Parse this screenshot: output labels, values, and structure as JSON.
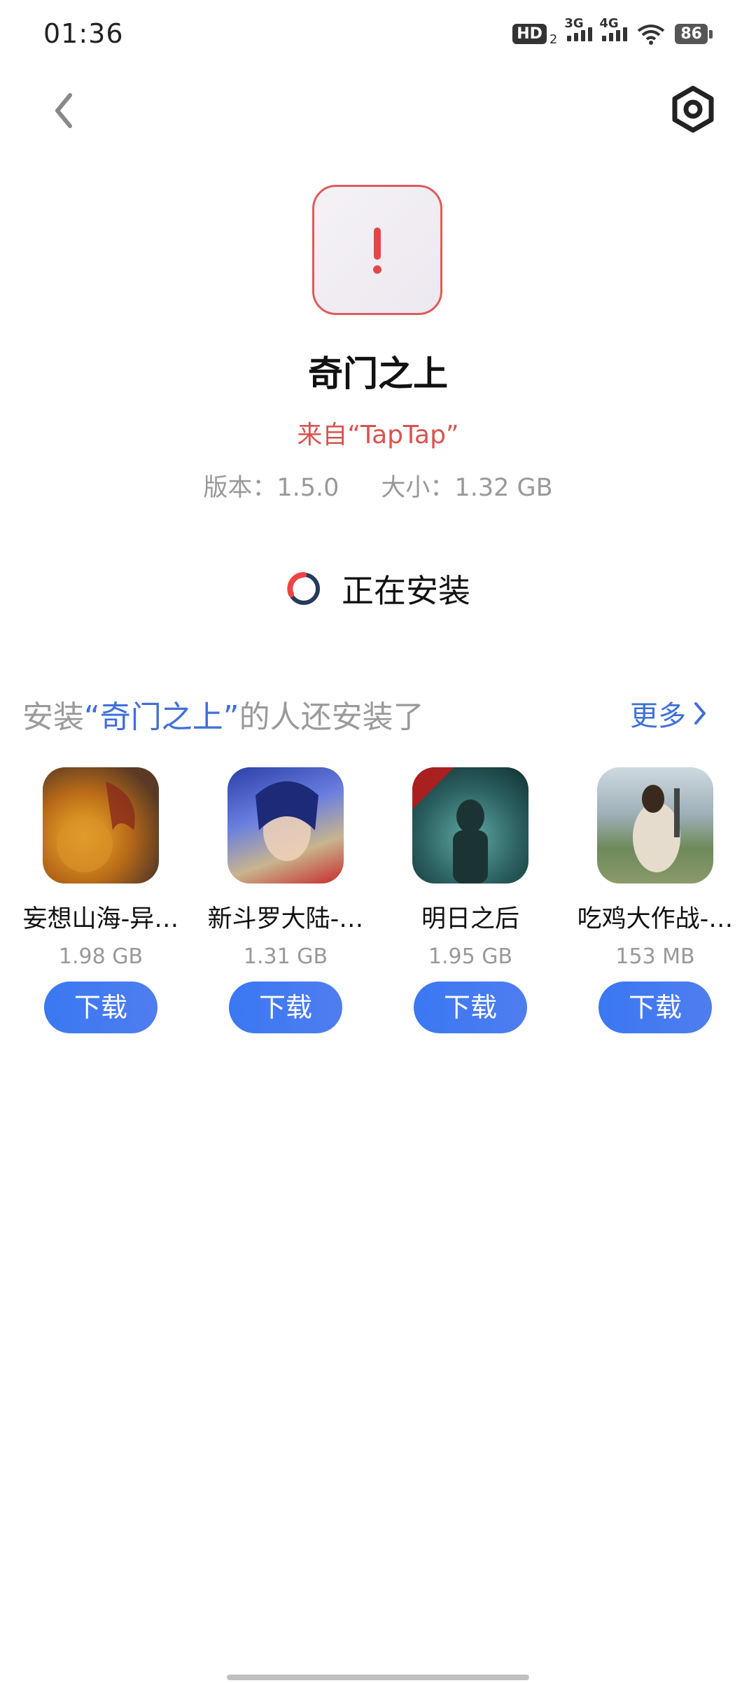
{
  "status_bar": {
    "time": "01:36",
    "hd_badge": "HD",
    "hd_sub": "2",
    "signal1": "3G",
    "signal2": "4G",
    "battery": "86"
  },
  "app": {
    "name": "奇门之上",
    "source": "来自“TapTap”",
    "version": "版本：1.5.0",
    "size": "大小：1.32 GB",
    "icon": "error-exclamation-icon"
  },
  "install": {
    "status": "正在安装",
    "accent": "#ef4444"
  },
  "recommend": {
    "heading_prefix": "安装",
    "heading_quote_open": "“",
    "heading_app": "奇门之上",
    "heading_quote_close": "”",
    "heading_suffix": "的人还安装了",
    "more": "更多",
    "items": [
      {
        "name": "妄想山海-异…",
        "size": "1.98 GB",
        "button": "下载",
        "icon": "dragon-game-icon"
      },
      {
        "name": "新斗罗大陆-…",
        "size": "1.31 GB",
        "button": "下载",
        "icon": "anime-hero-game-icon"
      },
      {
        "name": "明日之后",
        "size": "1.95 GB",
        "button": "下载",
        "icon": "survival-game-icon"
      },
      {
        "name": "吃鸡大作战-…",
        "size": "153 MB",
        "button": "下载",
        "icon": "cow-game-icon"
      }
    ]
  },
  "colors": {
    "primary": "#3f6fd8",
    "button": "#3a78f2",
    "error": "#d9534f"
  }
}
